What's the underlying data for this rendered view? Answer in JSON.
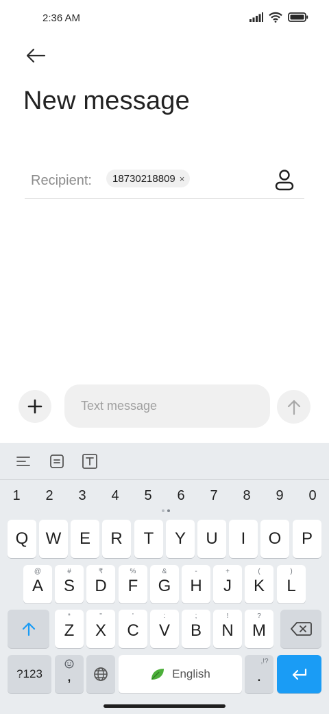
{
  "status_bar": {
    "time": "2:36 AM",
    "icons": [
      "signal-icon",
      "wifi-icon",
      "battery-icon"
    ]
  },
  "header": {
    "title": "New message",
    "back_icon": "arrow-left-icon"
  },
  "recipient": {
    "label": "Recipient:",
    "chips": [
      "18730218809"
    ],
    "chip_remove_glyph": "×",
    "contact_icon": "person-icon"
  },
  "composer": {
    "add_icon": "plus-icon",
    "placeholder": "Text message",
    "value": "",
    "send_icon": "arrow-up-icon"
  },
  "keyboard": {
    "toolbar_icons": [
      "align-left-icon",
      "document-icon",
      "text-format-icon"
    ],
    "number_row": [
      "1",
      "2",
      "3",
      "4",
      "5",
      "6",
      "7",
      "8",
      "9",
      "0"
    ],
    "row1": [
      "Q",
      "W",
      "E",
      "R",
      "T",
      "Y",
      "U",
      "I",
      "O",
      "P"
    ],
    "row2": [
      {
        "key": "A",
        "hint": "@"
      },
      {
        "key": "S",
        "hint": "#"
      },
      {
        "key": "D",
        "hint": "₹"
      },
      {
        "key": "F",
        "hint": "%"
      },
      {
        "key": "G",
        "hint": "&"
      },
      {
        "key": "H",
        "hint": "-"
      },
      {
        "key": "J",
        "hint": "+"
      },
      {
        "key": "K",
        "hint": "("
      },
      {
        "key": "L",
        "hint": ")"
      }
    ],
    "row3": [
      {
        "key": "Z",
        "hint": "*"
      },
      {
        "key": "X",
        "hint": "\""
      },
      {
        "key": "C",
        "hint": "'"
      },
      {
        "key": "V",
        "hint": ":"
      },
      {
        "key": "B",
        "hint": ";"
      },
      {
        "key": "N",
        "hint": "!"
      },
      {
        "key": "M",
        "hint": "?"
      }
    ],
    "symbols_label": "?123",
    "comma_label": ",",
    "space_label": "English",
    "period_label": ".",
    "period_hint": ",!?",
    "colors": {
      "background": "#e9ecef",
      "key": "#ffffff",
      "function_key": "#d5d9de",
      "accent": "#1a9cf5",
      "leaf": "#4caf3a"
    }
  }
}
